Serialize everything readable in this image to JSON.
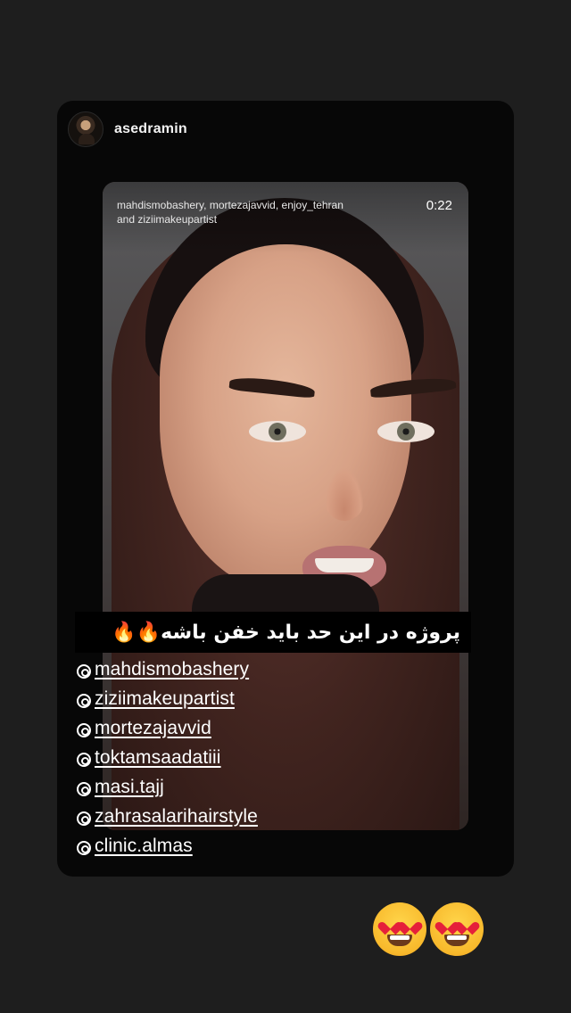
{
  "post": {
    "username": "asedramin",
    "avatar_icon": "profile-avatar"
  },
  "media": {
    "tagged_accounts_line1": "mahdismobashery, mortezajavvid, enjoy_tehran",
    "tagged_accounts_line2": "and ziziimakeupartist",
    "duration": "0:22"
  },
  "caption": {
    "text": "پروژه در این حد باید خفن باشه🔥🔥"
  },
  "mentions": [
    "mahdismobashery",
    "ziziimakeupartist",
    "mortezajavvid",
    "toktamsaadatiii",
    "masi.tajj",
    "zahrasalarihairstyle",
    "clinic.almas"
  ],
  "reactions": [
    "heart-eyes-emoji",
    "heart-eyes-emoji"
  ],
  "colors": {
    "background": "#1e1e1e",
    "card": "#070707",
    "caption_bg": "#000000"
  }
}
